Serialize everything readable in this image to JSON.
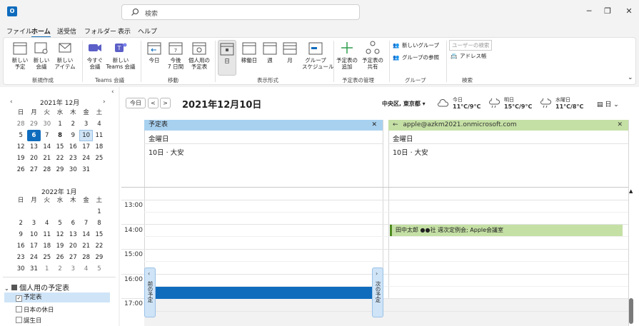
{
  "search": {
    "placeholder": "検索"
  },
  "menu": [
    "ファイル",
    "ホーム",
    "送受信",
    "フォルダー",
    "表示",
    "ヘルプ"
  ],
  "ribbon": {
    "new_appt": "新しい\n予定",
    "new_meeting": "新しい\n会議",
    "new_items": "新しい\nアイテム",
    "meet_now": "今すぐ\n会議",
    "teams_meeting": "新しい\nTeams 会議",
    "today": "今日",
    "next7": "今後\n7 日間",
    "personal": "個人用の\n予定表",
    "day": "日",
    "workweek": "稼働日",
    "week": "週",
    "month": "月",
    "schedule": "グループ\nスケジュール",
    "add_cal": "予定表の\n追加",
    "share_cal": "予定表の\n共有",
    "new_group": "新しいグループ",
    "browse_groups": "グループの参照",
    "user_search": "ユーザーの検索",
    "address_book": "アドレス帳",
    "groups": {
      "new": "新規作成",
      "teams": "Teams 会議",
      "move": "移動",
      "view": "表示形式",
      "manage": "予定表の管理",
      "group": "グループ",
      "search": "検索"
    }
  },
  "minical1": {
    "title": "2021年 12月",
    "headers": [
      "日",
      "月",
      "火",
      "水",
      "木",
      "金",
      "土"
    ],
    "days": [
      "28",
      "29",
      "30",
      "1",
      "2",
      "3",
      "4",
      "5",
      "6",
      "7",
      "8",
      "9",
      "10",
      "11",
      "12",
      "13",
      "14",
      "15",
      "16",
      "17",
      "18",
      "19",
      "20",
      "21",
      "22",
      "23",
      "24",
      "25",
      "26",
      "27",
      "28",
      "29",
      "30",
      "31",
      ""
    ]
  },
  "minical2": {
    "title": "2022年 1月",
    "headers": [
      "日",
      "月",
      "火",
      "水",
      "木",
      "金",
      "土"
    ],
    "days": [
      "",
      "",
      "",
      "",
      "",
      "",
      "1",
      "2",
      "3",
      "4",
      "5",
      "6",
      "7",
      "8",
      "9",
      "10",
      "11",
      "12",
      "13",
      "14",
      "15",
      "16",
      "17",
      "18",
      "19",
      "20",
      "21",
      "22",
      "23",
      "24",
      "25",
      "26",
      "27",
      "28",
      "29",
      "30",
      "31",
      "1",
      "2",
      "3",
      "4",
      "5"
    ]
  },
  "mycalendars": {
    "header": "個人用の予定表",
    "items": [
      "予定表",
      "日本の休日",
      "誕生日"
    ]
  },
  "toolbar": {
    "today": "今日",
    "prev": "<",
    "next": ">"
  },
  "date_title": "2021年12月10日",
  "location": "中央区, 東京都",
  "weather": [
    {
      "day": "今日",
      "temp": "11°C/9°C"
    },
    {
      "day": "明日",
      "temp": "15°C/9°C"
    },
    {
      "day": "水曜日",
      "temp": "11°C/8°C"
    }
  ],
  "view_select": "日",
  "columns": [
    {
      "title": "予定表",
      "dayname": "金曜日",
      "date": "10日 · 大安"
    },
    {
      "title": "apple@azkm2021.onmicrosoft.com",
      "dayname": "金曜日",
      "date": "10日 · 大安"
    }
  ],
  "hours": [
    "13:00",
    "14:00",
    "15:00",
    "16:00",
    "17:00"
  ],
  "event": "田中太郎 ●●社 週次定例会; Apple会議室",
  "prev_appt": "前の予定",
  "next_appt": "次の予定"
}
